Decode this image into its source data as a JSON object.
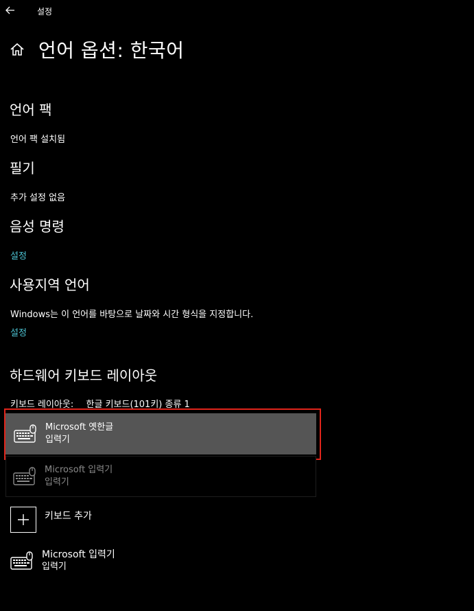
{
  "window": {
    "title": "설정"
  },
  "header": {
    "title": "언어 옵션: 한국어"
  },
  "sections": {
    "language_pack": {
      "heading": "언어 팩",
      "status": "언어 팩 설치됨"
    },
    "handwriting": {
      "heading": "필기",
      "status": "추가 설정 없음"
    },
    "speech": {
      "heading": "음성 명령",
      "link": "설정"
    },
    "regional": {
      "heading": "사용지역 언어",
      "description": "Windows는 이 언어를 바탕으로 날짜와 시간 형식을 지정합니다.",
      "link": "설정"
    },
    "hardware_keyboard": {
      "heading": "하드웨어 키보드 레이아웃",
      "layout_label": "키보드 레이아웃:",
      "layout_value": "한글 키보드(101키) 종류 1"
    }
  },
  "keyboards": {
    "items": [
      {
        "name": "Microsoft 옛한글",
        "type": "입력기",
        "icon": "keyboard-mouse-icon",
        "state": "selected"
      },
      {
        "name": "Microsoft 입력기",
        "type": "입력기",
        "icon": "keyboard-mouse-icon",
        "state": "disabled"
      }
    ],
    "add_label": "키보드 추가",
    "installed": {
      "name": "Microsoft 입력기",
      "type": "입력기",
      "icon": "keyboard-mouse-icon"
    }
  },
  "colors": {
    "background": "#000000",
    "accent_link": "#4cc2d1",
    "selected_row": "#555555",
    "highlight_border": "#e1251b"
  }
}
